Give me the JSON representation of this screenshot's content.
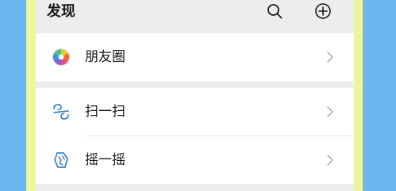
{
  "header": {
    "title": "发现",
    "search_icon": "search-icon",
    "add_icon": "plus-circle-icon"
  },
  "menu": {
    "moments": {
      "label": "朋友圈",
      "icon": "moments-aperture-icon"
    },
    "scan": {
      "label": "扫一扫",
      "icon": "scan-icon"
    },
    "shake": {
      "label": "摇一摇",
      "icon": "shake-icon"
    }
  },
  "colors": {
    "background": "#6BB5F0",
    "frame": "#ECF59A",
    "screen": "#EDEDED",
    "accent": "#3B82C4"
  }
}
